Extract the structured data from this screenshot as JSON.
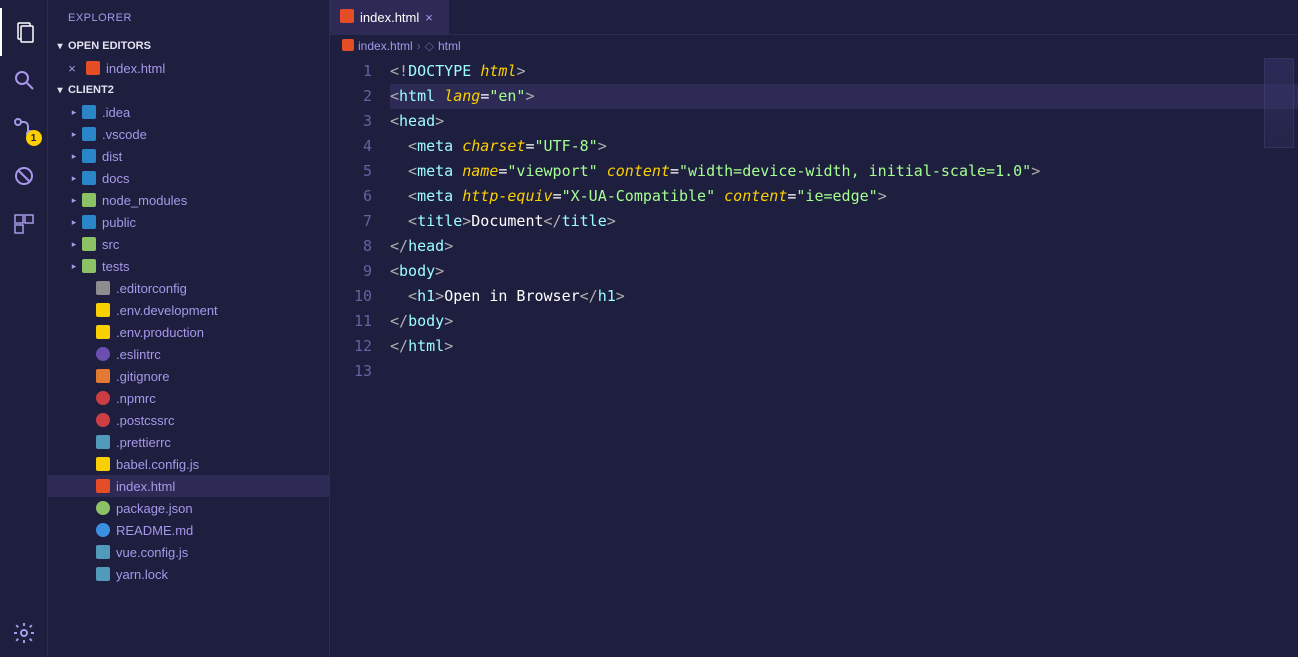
{
  "sidebar_title": "EXPLORER",
  "sections": {
    "open_editors": "OPEN EDITORS",
    "project": "CLIENT2"
  },
  "open_editors": [
    {
      "label": "index.html",
      "icon": "html5"
    }
  ],
  "tree": [
    {
      "label": ".idea",
      "type": "folder",
      "icon": "folder",
      "depth": 1
    },
    {
      "label": ".vscode",
      "type": "folder",
      "icon": "folder",
      "depth": 1
    },
    {
      "label": "dist",
      "type": "folder",
      "icon": "folder",
      "depth": 1
    },
    {
      "label": "docs",
      "type": "folder",
      "icon": "folder",
      "depth": 1
    },
    {
      "label": "node_modules",
      "type": "folder",
      "icon": "folder-green",
      "depth": 1
    },
    {
      "label": "public",
      "type": "folder",
      "icon": "folder",
      "depth": 1
    },
    {
      "label": "src",
      "type": "folder",
      "icon": "folder-green",
      "depth": 1
    },
    {
      "label": "tests",
      "type": "folder",
      "icon": "folder-green",
      "depth": 1
    },
    {
      "label": ".editorconfig",
      "type": "file",
      "icon": "gear",
      "depth": 2
    },
    {
      "label": ".env.development",
      "type": "file",
      "icon": "yellow",
      "depth": 2
    },
    {
      "label": ".env.production",
      "type": "file",
      "icon": "yellow",
      "depth": 2
    },
    {
      "label": ".eslintrc",
      "type": "file",
      "icon": "purple",
      "depth": 2
    },
    {
      "label": ".gitignore",
      "type": "file",
      "icon": "orange",
      "depth": 2
    },
    {
      "label": ".npmrc",
      "type": "file",
      "icon": "red",
      "depth": 2
    },
    {
      "label": ".postcssrc",
      "type": "file",
      "icon": "red",
      "depth": 2
    },
    {
      "label": ".prettierrc",
      "type": "file",
      "icon": "lightblue",
      "depth": 2
    },
    {
      "label": "babel.config.js",
      "type": "file",
      "icon": "yellow",
      "depth": 2
    },
    {
      "label": "index.html",
      "type": "file",
      "icon": "html5",
      "depth": 2,
      "selected": true
    },
    {
      "label": "package.json",
      "type": "file",
      "icon": "green",
      "depth": 2
    },
    {
      "label": "README.md",
      "type": "file",
      "icon": "blueround",
      "depth": 2
    },
    {
      "label": "vue.config.js",
      "type": "file",
      "icon": "lightblue",
      "depth": 2
    },
    {
      "label": "yarn.lock",
      "type": "file",
      "icon": "lightblue",
      "depth": 2
    }
  ],
  "tab": {
    "label": "index.html"
  },
  "breadcrumbs": [
    "index.html",
    "html"
  ],
  "scm_badge": "1",
  "code_lines": [
    [
      {
        "c": "p",
        "t": "<"
      },
      {
        "c": "p",
        "t": "!"
      },
      {
        "c": "tg",
        "t": "DOCTYPE "
      },
      {
        "c": "doct",
        "t": "html"
      },
      {
        "c": "p",
        "t": ">"
      }
    ],
    [
      {
        "c": "p",
        "t": "<"
      },
      {
        "c": "tg",
        "t": "html "
      },
      {
        "c": "at",
        "t": "lang"
      },
      {
        "c": "p2",
        "t": "="
      },
      {
        "c": "st",
        "t": "\"en\""
      },
      {
        "c": "p",
        "t": ">"
      }
    ],
    [
      {
        "c": "p",
        "t": "<"
      },
      {
        "c": "tg",
        "t": "head"
      },
      {
        "c": "p",
        "t": ">"
      }
    ],
    [
      {
        "c": "p",
        "t": "  <"
      },
      {
        "c": "tg",
        "t": "meta "
      },
      {
        "c": "at",
        "t": "charset"
      },
      {
        "c": "p2",
        "t": "="
      },
      {
        "c": "st",
        "t": "\"UTF-8\""
      },
      {
        "c": "p",
        "t": ">"
      }
    ],
    [
      {
        "c": "p",
        "t": "  <"
      },
      {
        "c": "tg",
        "t": "meta "
      },
      {
        "c": "at",
        "t": "name"
      },
      {
        "c": "p2",
        "t": "="
      },
      {
        "c": "st",
        "t": "\"viewport\""
      },
      {
        "c": "tg",
        "t": " "
      },
      {
        "c": "at",
        "t": "content"
      },
      {
        "c": "p2",
        "t": "="
      },
      {
        "c": "st",
        "t": "\"width=device-width, initial-scale=1.0\""
      },
      {
        "c": "p",
        "t": ">"
      }
    ],
    [
      {
        "c": "p",
        "t": "  <"
      },
      {
        "c": "tg",
        "t": "meta "
      },
      {
        "c": "at",
        "t": "http-equiv"
      },
      {
        "c": "p2",
        "t": "="
      },
      {
        "c": "st",
        "t": "\"X-UA-Compatible\""
      },
      {
        "c": "tg",
        "t": " "
      },
      {
        "c": "at",
        "t": "content"
      },
      {
        "c": "p2",
        "t": "="
      },
      {
        "c": "st",
        "t": "\"ie=edge\""
      },
      {
        "c": "p",
        "t": ">"
      }
    ],
    [
      {
        "c": "p",
        "t": "  <"
      },
      {
        "c": "tg",
        "t": "title"
      },
      {
        "c": "p",
        "t": ">"
      },
      {
        "c": "tx",
        "t": "Document"
      },
      {
        "c": "p",
        "t": "</"
      },
      {
        "c": "tg",
        "t": "title"
      },
      {
        "c": "p",
        "t": ">"
      }
    ],
    [
      {
        "c": "p",
        "t": "</"
      },
      {
        "c": "tg",
        "t": "head"
      },
      {
        "c": "p",
        "t": ">"
      }
    ],
    [
      {
        "c": "p",
        "t": "<"
      },
      {
        "c": "tg",
        "t": "body"
      },
      {
        "c": "p",
        "t": ">"
      }
    ],
    [
      {
        "c": "p",
        "t": "  <"
      },
      {
        "c": "tg",
        "t": "h1"
      },
      {
        "c": "p",
        "t": ">"
      },
      {
        "c": "tx",
        "t": "Open in Browser"
      },
      {
        "c": "p",
        "t": "</"
      },
      {
        "c": "tg",
        "t": "h1"
      },
      {
        "c": "p",
        "t": ">"
      }
    ],
    [
      {
        "c": "p",
        "t": "</"
      },
      {
        "c": "tg",
        "t": "body"
      },
      {
        "c": "p",
        "t": ">"
      }
    ],
    [
      {
        "c": "p",
        "t": "</"
      },
      {
        "c": "tg",
        "t": "html"
      },
      {
        "c": "p",
        "t": ">"
      }
    ],
    []
  ],
  "highlighted_line": 2
}
